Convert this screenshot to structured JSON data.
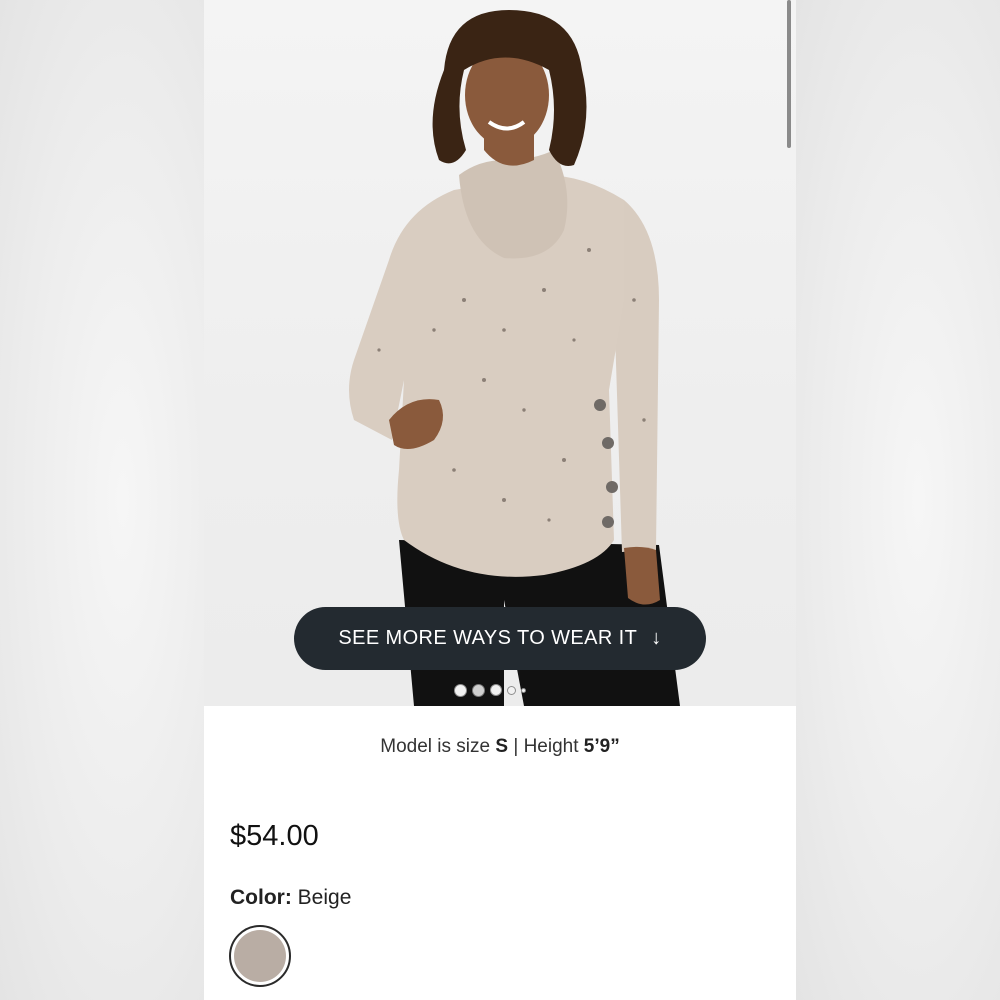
{
  "cta": {
    "label": "SEE MORE WAYS TO WEAR IT",
    "arrow": "↓"
  },
  "carousel": {
    "count": 5,
    "active_index": 1
  },
  "model_info": {
    "prefix": "Model is size ",
    "size": "S",
    "separator": " | Height ",
    "height": "5’9”"
  },
  "product": {
    "price": "$54.00",
    "color_label": "Color:",
    "color_value": "Beige",
    "swatch_color": "#b9ada4"
  },
  "icons": {
    "scroll": "scrollbar-indicator",
    "arrow": "arrow-down-icon"
  }
}
